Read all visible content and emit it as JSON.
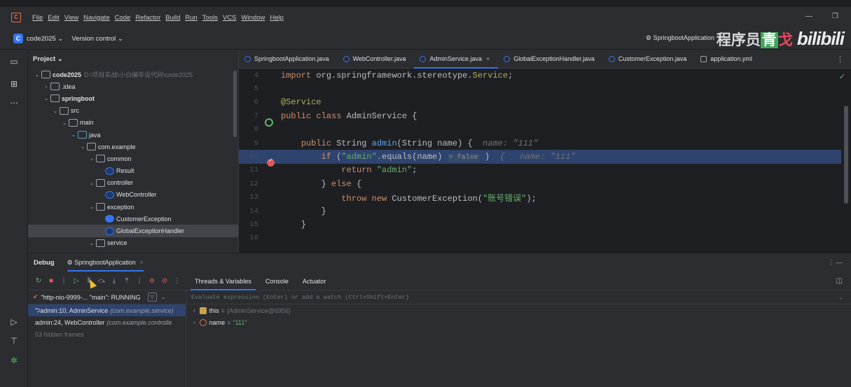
{
  "menubar": {
    "items": [
      "File",
      "Edit",
      "View",
      "Navigate",
      "Code",
      "Refactor",
      "Build",
      "Run",
      "Tools",
      "VCS",
      "Window",
      "Help"
    ]
  },
  "toolbar": {
    "project_badge": "C",
    "project_name": "code2025",
    "version_control": "Version control",
    "run_config": "SpringbootApplication"
  },
  "watermark": {
    "text_a": "程序员",
    "text_b": "青",
    "text_c": "戈",
    "logo": "bilibili"
  },
  "project_panel": {
    "title": "Project",
    "tree": [
      {
        "label": "code2025",
        "path": "D:\\项目实战\\小白编毕设代码\\code2025",
        "depth": 0,
        "open": true,
        "bold": true,
        "icon": "folder"
      },
      {
        "label": ".idea",
        "depth": 1,
        "open": false,
        "icon": "folder"
      },
      {
        "label": "springboot",
        "depth": 1,
        "open": true,
        "bold": true,
        "icon": "folder"
      },
      {
        "label": "src",
        "depth": 2,
        "open": true,
        "icon": "folder"
      },
      {
        "label": "main",
        "depth": 3,
        "open": true,
        "icon": "folder"
      },
      {
        "label": "java",
        "depth": 4,
        "open": true,
        "icon": "src"
      },
      {
        "label": "com.example",
        "depth": 5,
        "open": true,
        "icon": "pkg"
      },
      {
        "label": "common",
        "depth": 6,
        "open": true,
        "icon": "pkg"
      },
      {
        "label": "Result",
        "depth": 7,
        "icon": "cls"
      },
      {
        "label": "controller",
        "depth": 6,
        "open": true,
        "icon": "pkg"
      },
      {
        "label": "WebController",
        "depth": 7,
        "icon": "cls"
      },
      {
        "label": "exception",
        "depth": 6,
        "open": true,
        "icon": "pkg"
      },
      {
        "label": "CustomerException",
        "depth": 7,
        "icon": "exc"
      },
      {
        "label": "GlobalExceptionHandler",
        "depth": 7,
        "icon": "cls",
        "selected": true
      },
      {
        "label": "service",
        "depth": 6,
        "open": true,
        "icon": "pkg"
      }
    ]
  },
  "editor": {
    "tabs": [
      {
        "label": "SpringbootApplication.java",
        "icon": "cls"
      },
      {
        "label": "WebController.java",
        "icon": "cls"
      },
      {
        "label": "AdminService.java",
        "icon": "cls",
        "active": true,
        "close": "×"
      },
      {
        "label": "GlobalExceptionHandler.java",
        "icon": "cls"
      },
      {
        "label": "CustomerException.java",
        "icon": "exc"
      },
      {
        "label": "application.yml",
        "icon": "yml"
      }
    ],
    "more": "⋮",
    "status_check": "✓",
    "lines": [
      {
        "n": "4",
        "html": "<span class='kw'>import</span> org.springframework.stereotype.<span class='ann'>Service</span>;"
      },
      {
        "n": "5",
        "html": ""
      },
      {
        "n": "6",
        "html": "<span class='ann'>@Service</span>"
      },
      {
        "n": "7",
        "html": "<span class='kw'>public class</span> AdminService {",
        "bean": true
      },
      {
        "n": "8",
        "html": ""
      },
      {
        "n": "9",
        "html": "    <span class='kw'>public</span> String <span class='fn'>admin</span>(String name) {  <span class='hint'>name: \"111\"</span>"
      },
      {
        "n": "10",
        "html": "        <span class='kw'>if</span> (<span class='str'>\"admin\"</span>.equals(name) <span class='inl'>= false</span> )  <span class='hint'>{   name: \"111\"</span>",
        "hl": true,
        "bp": true
      },
      {
        "n": "11",
        "html": "            <span class='kw'>return</span> <span class='str'>\"admin\"</span>;"
      },
      {
        "n": "12",
        "html": "        } <span class='kw'>else</span> {"
      },
      {
        "n": "13",
        "html": "            <span class='kw'>throw new</span> CustomerException(<span class='str'>\"账号错误\"</span>);"
      },
      {
        "n": "14",
        "html": "        }"
      },
      {
        "n": "15",
        "html": "    }"
      },
      {
        "n": "16",
        "html": ""
      }
    ]
  },
  "debug": {
    "title": "Debug",
    "config": "SpringbootApplication",
    "config_close": "×",
    "header_more": "⋮  —",
    "tabs": [
      "Threads & Variables",
      "Console",
      "Actuator"
    ],
    "thread": "\"http-nio-9999-... \"main\": RUNNING",
    "frames": [
      {
        "method": "admin:10, AdminService",
        "pkg": "(com.example.service)",
        "selected": true
      },
      {
        "method": "admin:24, WebController",
        "pkg": "(com.example.controlle"
      },
      {
        "method": "53 hidden frames",
        "hidden": true
      }
    ],
    "watch_placeholder": "Evaluate expression (Enter) or add a watch (Ctrl+Shift+Enter)",
    "variables": [
      {
        "name": "this",
        "eq": "=",
        "value": "{AdminService@6956}",
        "kind": "field"
      },
      {
        "name": "name",
        "eq": "=",
        "value": "\"111\"",
        "kind": "param",
        "string": true
      }
    ]
  }
}
